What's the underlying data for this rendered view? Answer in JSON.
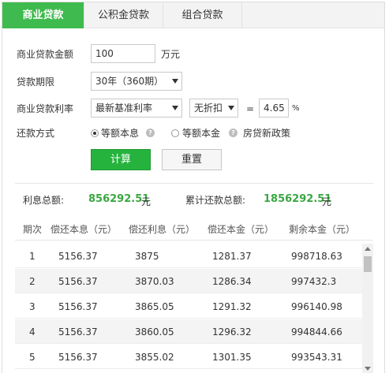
{
  "tabs": [
    {
      "label": "商业贷款"
    },
    {
      "label": "公积金贷款"
    },
    {
      "label": "组合贷款"
    }
  ],
  "form": {
    "amount_label": "商业贷款金额",
    "amount_value": "100",
    "amount_unit": "万元",
    "term_label": "贷款期限",
    "term_value": "30年（360期）",
    "rate_label": "商业贷款利率",
    "rate_type": "最新基准利率",
    "discount": "无折扣",
    "equals": "=",
    "rate_value": "4.65",
    "rate_unit": "%",
    "method_label": "还款方式",
    "method_option1": "等额本息",
    "method_option2": "等额本金",
    "policy_link": "房贷新政策",
    "help_glyph": "?"
  },
  "buttons": {
    "calc": "计算",
    "reset": "重置"
  },
  "summary": {
    "interest_label": "利息总额:",
    "interest_value": "856292.51",
    "interest_unit": "元",
    "total_label": "累计还款总额:",
    "total_value": "1856292.51",
    "total_unit": "元"
  },
  "table": {
    "headers": [
      "期次",
      "偿还本息（元）",
      "偿还利息（元）",
      "偿还本金（元）",
      "剩余本金（元）"
    ],
    "rows": [
      [
        "1",
        "5156.37",
        "3875",
        "1281.37",
        "998718.63"
      ],
      [
        "2",
        "5156.37",
        "3870.03",
        "1286.34",
        "997432.3"
      ],
      [
        "3",
        "5156.37",
        "3865.05",
        "1291.32",
        "996140.98"
      ],
      [
        "4",
        "5156.37",
        "3860.05",
        "1296.32",
        "994844.66"
      ],
      [
        "5",
        "5156.37",
        "3855.02",
        "1301.35",
        "993543.31"
      ]
    ]
  },
  "colors": {
    "accent": "#3fba4e",
    "button": "#25b33d",
    "value_green": "#3aa742"
  }
}
